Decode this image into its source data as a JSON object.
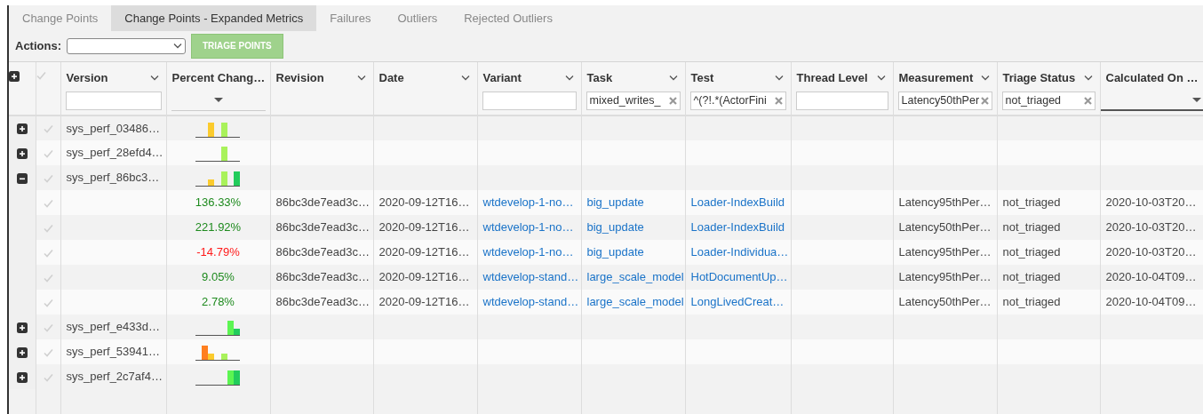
{
  "tabs": [
    {
      "label": "Change Points",
      "selected": false
    },
    {
      "label": "Change Points - Expanded Metrics",
      "selected": true
    },
    {
      "label": "Failures",
      "selected": false
    },
    {
      "label": "Outliers",
      "selected": false
    },
    {
      "label": "Rejected Outliers",
      "selected": false
    }
  ],
  "actions": {
    "label": "Actions:",
    "button": "TRIAGE POINTS"
  },
  "table": {
    "columns": [
      {
        "label": "Version",
        "kind": "text"
      },
      {
        "label": "Percent Chang…",
        "kind": "select"
      },
      {
        "label": "Revision",
        "kind": "none"
      },
      {
        "label": "Date",
        "kind": "none"
      },
      {
        "label": "Variant",
        "kind": "text"
      },
      {
        "label": "Task",
        "kind": "text",
        "value": "mixed_writes_",
        "clearable": true
      },
      {
        "label": "Test",
        "kind": "text",
        "value": "^(?!.*(ActorFini",
        "clearable": true
      },
      {
        "label": "Thread Level",
        "kind": "text"
      },
      {
        "label": "Measurement",
        "kind": "text",
        "value": "Latency50thPer",
        "clearable": true
      },
      {
        "label": "Triage Status",
        "kind": "text",
        "value": "not_triaged",
        "clearable": true
      },
      {
        "label": "Calculated On …",
        "kind": "underline"
      }
    ],
    "rows": [
      {
        "kind": "group",
        "expanded": false,
        "version": "sys_perf_03486…"
      },
      {
        "kind": "group",
        "expanded": false,
        "version": "sys_perf_28efd4…"
      },
      {
        "kind": "group",
        "expanded": true,
        "version": "sys_perf_86bc3…"
      },
      {
        "kind": "detail",
        "percent": "136.33%",
        "color": "#1e8a1e",
        "revision": "86bc3de7ead3c…",
        "date": "2020-09-12T16…",
        "variant": "wtdevelop-1-no…",
        "task": "big_update",
        "test": "Loader-IndexBuild",
        "measurement": "Latency95thPer…",
        "triage_status": "not_triaged",
        "calculated_on": "2020-10-03T20…"
      },
      {
        "kind": "detail",
        "percent": "221.92%",
        "color": "#1e8a1e",
        "revision": "86bc3de7ead3c…",
        "date": "2020-09-12T16…",
        "variant": "wtdevelop-1-no…",
        "task": "big_update",
        "test": "Loader-IndexBuild",
        "measurement": "Latency50thPer…",
        "triage_status": "not_triaged",
        "calculated_on": "2020-10-03T20…"
      },
      {
        "kind": "detail",
        "percent": "-14.79%",
        "color": "#ff1a1a",
        "revision": "86bc3de7ead3c…",
        "date": "2020-09-12T16…",
        "variant": "wtdevelop-1-no…",
        "task": "big_update",
        "test": "Loader-Individua…",
        "measurement": "Latency95thPer…",
        "triage_status": "not_triaged",
        "calculated_on": "2020-10-03T20…"
      },
      {
        "kind": "detail",
        "percent": "9.05%",
        "color": "#1e8a1e",
        "revision": "86bc3de7ead3c…",
        "date": "2020-09-12T16…",
        "variant": "wtdevelop-stand…",
        "task": "large_scale_model",
        "test": "HotDocumentUp…",
        "measurement": "Latency95thPer…",
        "triage_status": "not_triaged",
        "calculated_on": "2020-10-04T09…"
      },
      {
        "kind": "detail",
        "percent": "2.78%",
        "color": "#1e8a1e",
        "revision": "86bc3de7ead3c…",
        "date": "2020-09-12T16…",
        "variant": "wtdevelop-stand…",
        "task": "large_scale_model",
        "test": "LongLivedCreat…",
        "measurement": "Latency50thPer…",
        "triage_status": "not_triaged",
        "calculated_on": "2020-10-04T09…"
      },
      {
        "kind": "group",
        "expanded": false,
        "version": "sys_perf_e433d…"
      },
      {
        "kind": "group",
        "expanded": false,
        "version": "sys_perf_53941…"
      },
      {
        "kind": "group",
        "expanded": false,
        "version": "sys_perf_2c7af4…"
      }
    ]
  }
}
